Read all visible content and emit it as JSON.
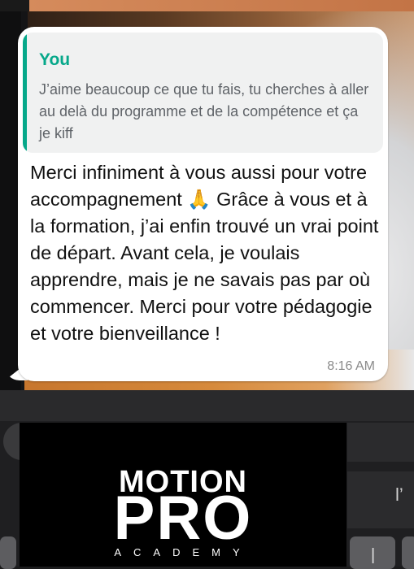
{
  "message": {
    "quote": {
      "author": "You",
      "text": "J’aime beaucoup ce que tu fais, tu cherches à aller au delà du programme et de la compétence et ça je kiff"
    },
    "text": "Merci infiniment à vous aussi pour votre accompagnement 🙏 Grâce à vous et à la formation, j’ai enfin trouvé un vrai point de départ. Avant cela, je voulais apprendre, mais je ne savais pas par où commencer. Merci pour votre pédagogie et votre bienveillance !",
    "time": "8:16 AM"
  },
  "keyboard": {
    "visible_key": "l’",
    "bottom_key": "|"
  },
  "logo": {
    "line1": "MOTION",
    "line2": "PRO",
    "line3": "ACADEMY"
  },
  "colors": {
    "quote_accent": "#06a88a",
    "bubble": "#ffffff",
    "logo_background": "#000000"
  }
}
